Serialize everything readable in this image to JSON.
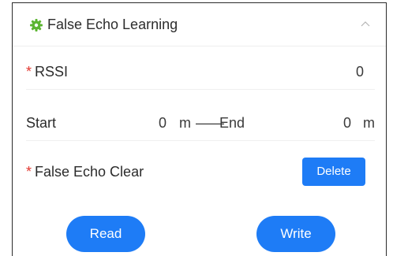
{
  "section": {
    "title": "False Echo Learning",
    "icon": "gear-icon",
    "collapse_icon": "chevron-up-icon",
    "accent": "#5cb531"
  },
  "rssi": {
    "required_mark": "*",
    "label": "RSSI",
    "value": "0"
  },
  "range": {
    "start_label": "Start",
    "start_value": "0",
    "start_unit": "m",
    "separator": "——",
    "end_label": "End",
    "end_value": "0",
    "end_unit": "m"
  },
  "clear": {
    "required_mark": "*",
    "label": "False Echo Clear",
    "button_label": "Delete"
  },
  "actions": {
    "read_label": "Read",
    "write_label": "Write"
  },
  "colors": {
    "primary": "#1e7cf6",
    "required": "#e2372f"
  }
}
